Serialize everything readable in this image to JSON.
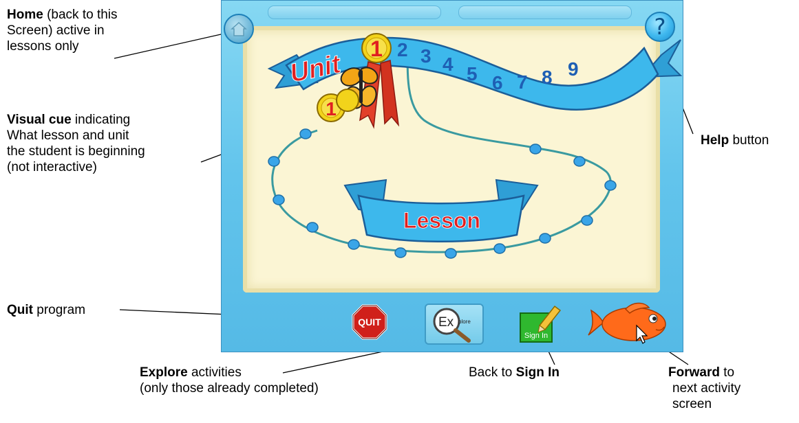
{
  "annotations": {
    "home": {
      "bold": "Home",
      "l1_rest": " (back to this",
      "l2": "Screen) active in",
      "l3": "lessons only"
    },
    "visual_cue": {
      "bold": "Visual cue",
      "l1_rest": " indicating",
      "l2": "What lesson and unit",
      "l3": "the student is beginning",
      "l4": "(not interactive)"
    },
    "quit": {
      "bold": "Quit",
      "rest": " program"
    },
    "explore": {
      "bold": "Explore",
      "rest": " activities",
      "l2": "(only those already completed)"
    },
    "signin": {
      "pre": "Back to ",
      "bold": "Sign In"
    },
    "forward": {
      "bold": "Forward",
      "rest": " to",
      "l2": "next activity",
      "l3": "screen"
    },
    "help": {
      "bold": "Help",
      "rest": " button"
    }
  },
  "app": {
    "unit_banner": {
      "label": "Unit",
      "current_unit": "1",
      "other_units": [
        "2",
        "3",
        "4",
        "5",
        "6",
        "7",
        "8",
        "9"
      ]
    },
    "lesson_marker": "1",
    "lesson_banner": "Lesson",
    "buttons": {
      "quit": "QUIT",
      "explore_big": "Ex",
      "explore_small": "plore",
      "sign_in": "Sign In",
      "help": "?"
    },
    "colors": {
      "frame": "#62c4ec",
      "board": "#fbf5d4",
      "ribbon": "#3db8ec",
      "ribbon_text_red": "#e02020",
      "unit_number_blue": "#1e5fb4",
      "path": "#3a9aa0",
      "path_dot": "#3aa5e8",
      "medal": "#f2d31b"
    }
  }
}
